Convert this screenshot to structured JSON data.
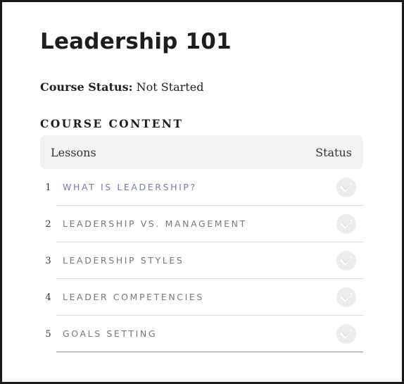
{
  "course": {
    "title": "Leadership 101",
    "status_label": "Course Status:",
    "status_value": "Not Started"
  },
  "content": {
    "heading": "COURSE CONTENT",
    "columns": {
      "lessons": "Lessons",
      "status": "Status"
    },
    "lessons": [
      {
        "number": "1",
        "title": "WHAT IS LEADERSHIP?",
        "status_icon": "checkmark-icon",
        "completed": false
      },
      {
        "number": "2",
        "title": "LEADERSHIP VS. MANAGEMENT",
        "status_icon": "checkmark-icon",
        "completed": false
      },
      {
        "number": "3",
        "title": "LEADERSHIP STYLES",
        "status_icon": "checkmark-icon",
        "completed": false
      },
      {
        "number": "4",
        "title": "LEADER COMPETENCIES",
        "status_icon": "checkmark-icon",
        "completed": false
      },
      {
        "number": "5",
        "title": "GOALS SETTING",
        "status_icon": "checkmark-icon",
        "completed": false
      }
    ]
  },
  "colors": {
    "active_link": "#6a7fb0",
    "inactive_link": "#777777",
    "header_bg": "#f2f2f2",
    "check_bg": "#ececec"
  }
}
